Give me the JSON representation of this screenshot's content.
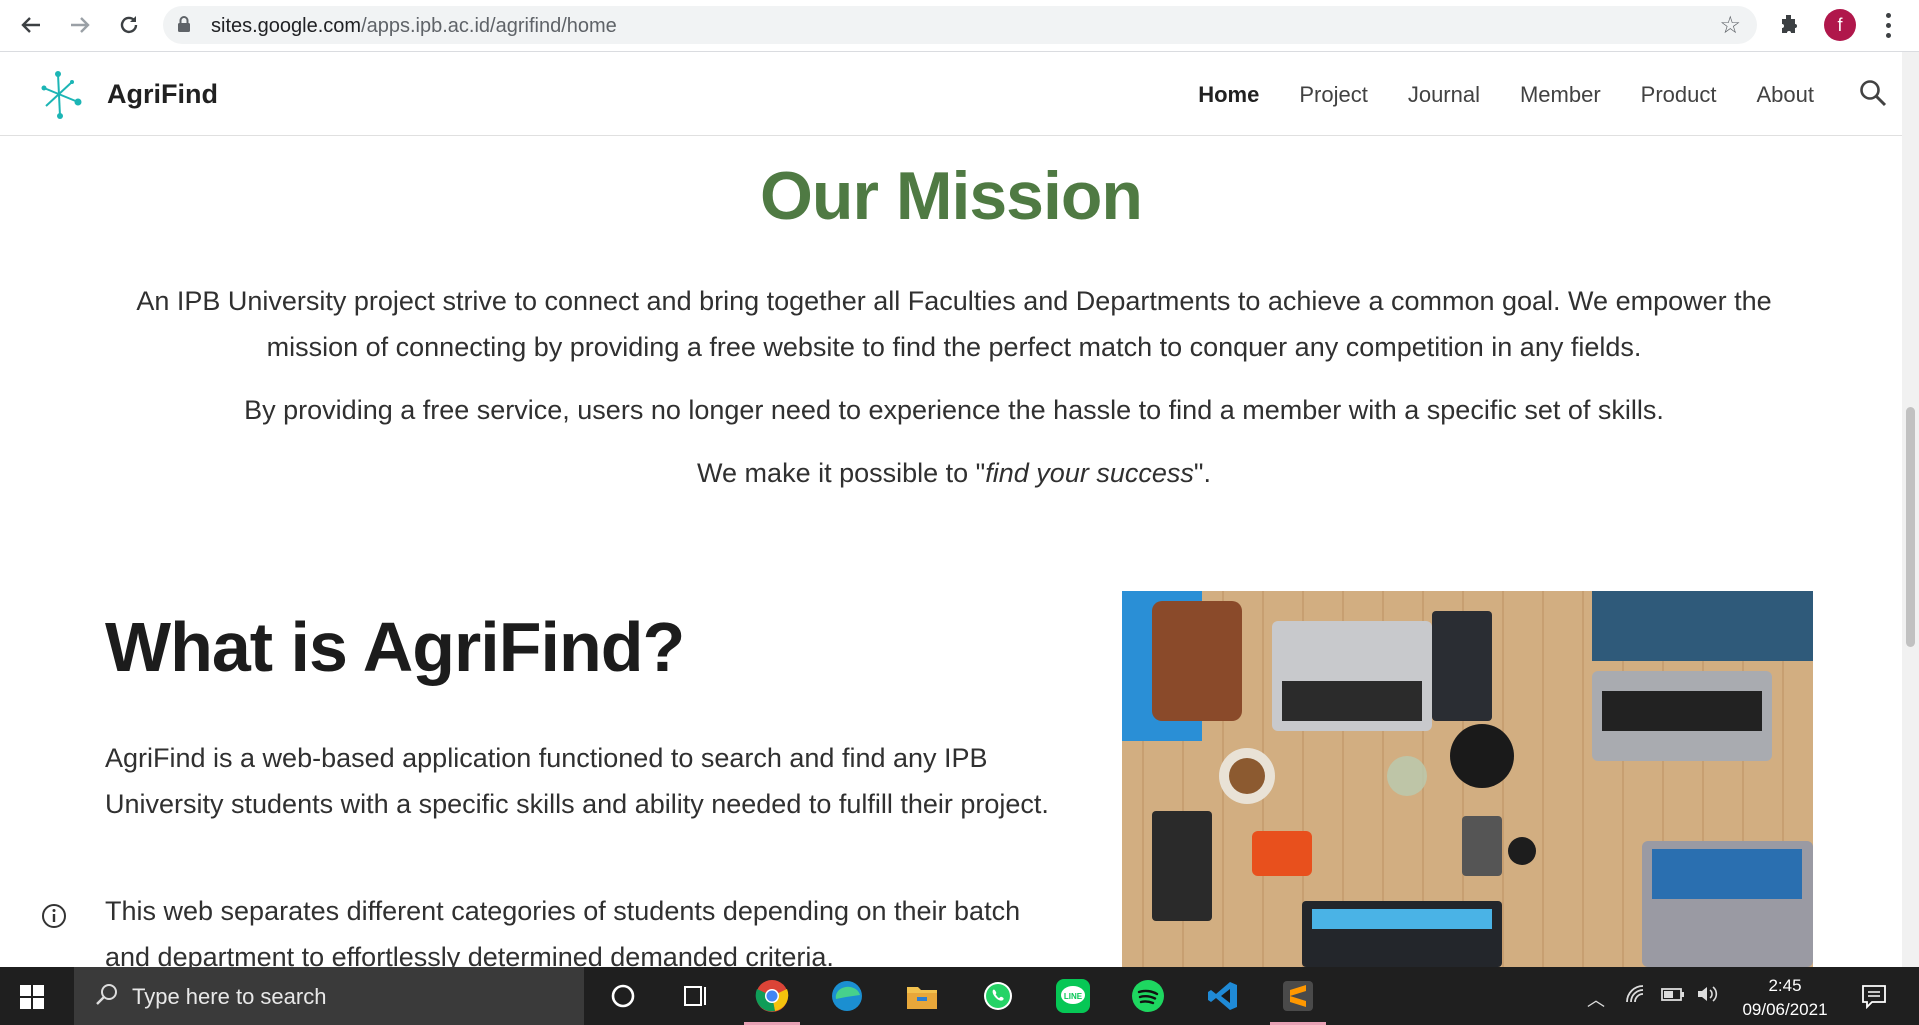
{
  "browser": {
    "url_host": "sites.google.com",
    "url_path": "/apps.ipb.ac.id/agrifind/home",
    "profile_initial": "f"
  },
  "site": {
    "name": "AgriFind",
    "nav": [
      "Home",
      "Project",
      "Journal",
      "Member",
      "Product",
      "About"
    ],
    "active_nav": "Home"
  },
  "mission": {
    "title": "Our Mission",
    "p1": "An IPB University project strive to connect and bring together all Faculties and Departments to achieve a common goal. We empower the mission of connecting by providing a free website to find the perfect match to conquer any competition in any fields.",
    "p2": "By providing a free service, users no longer need to experience the hassle to find a member with a specific set of skills.",
    "p3_before": "We make it possible to \"",
    "p3_em": "find your success",
    "p3_after": "\"."
  },
  "what": {
    "title": "What is AgriFind?",
    "p1": "AgriFind is a web-based application functioned to search and find any IPB University students with a specific skills and ability needed to fulfill their project.",
    "p2": "This web separates different categories of students depending on their batch and department to effortlessly determined demanded criteria."
  },
  "taskbar": {
    "search_placeholder": "Type here to search",
    "time": "2:45",
    "date": "09/06/2021"
  },
  "colors": {
    "mission_green": "#4f7a43",
    "logo_teal": "#1cb5b5"
  }
}
